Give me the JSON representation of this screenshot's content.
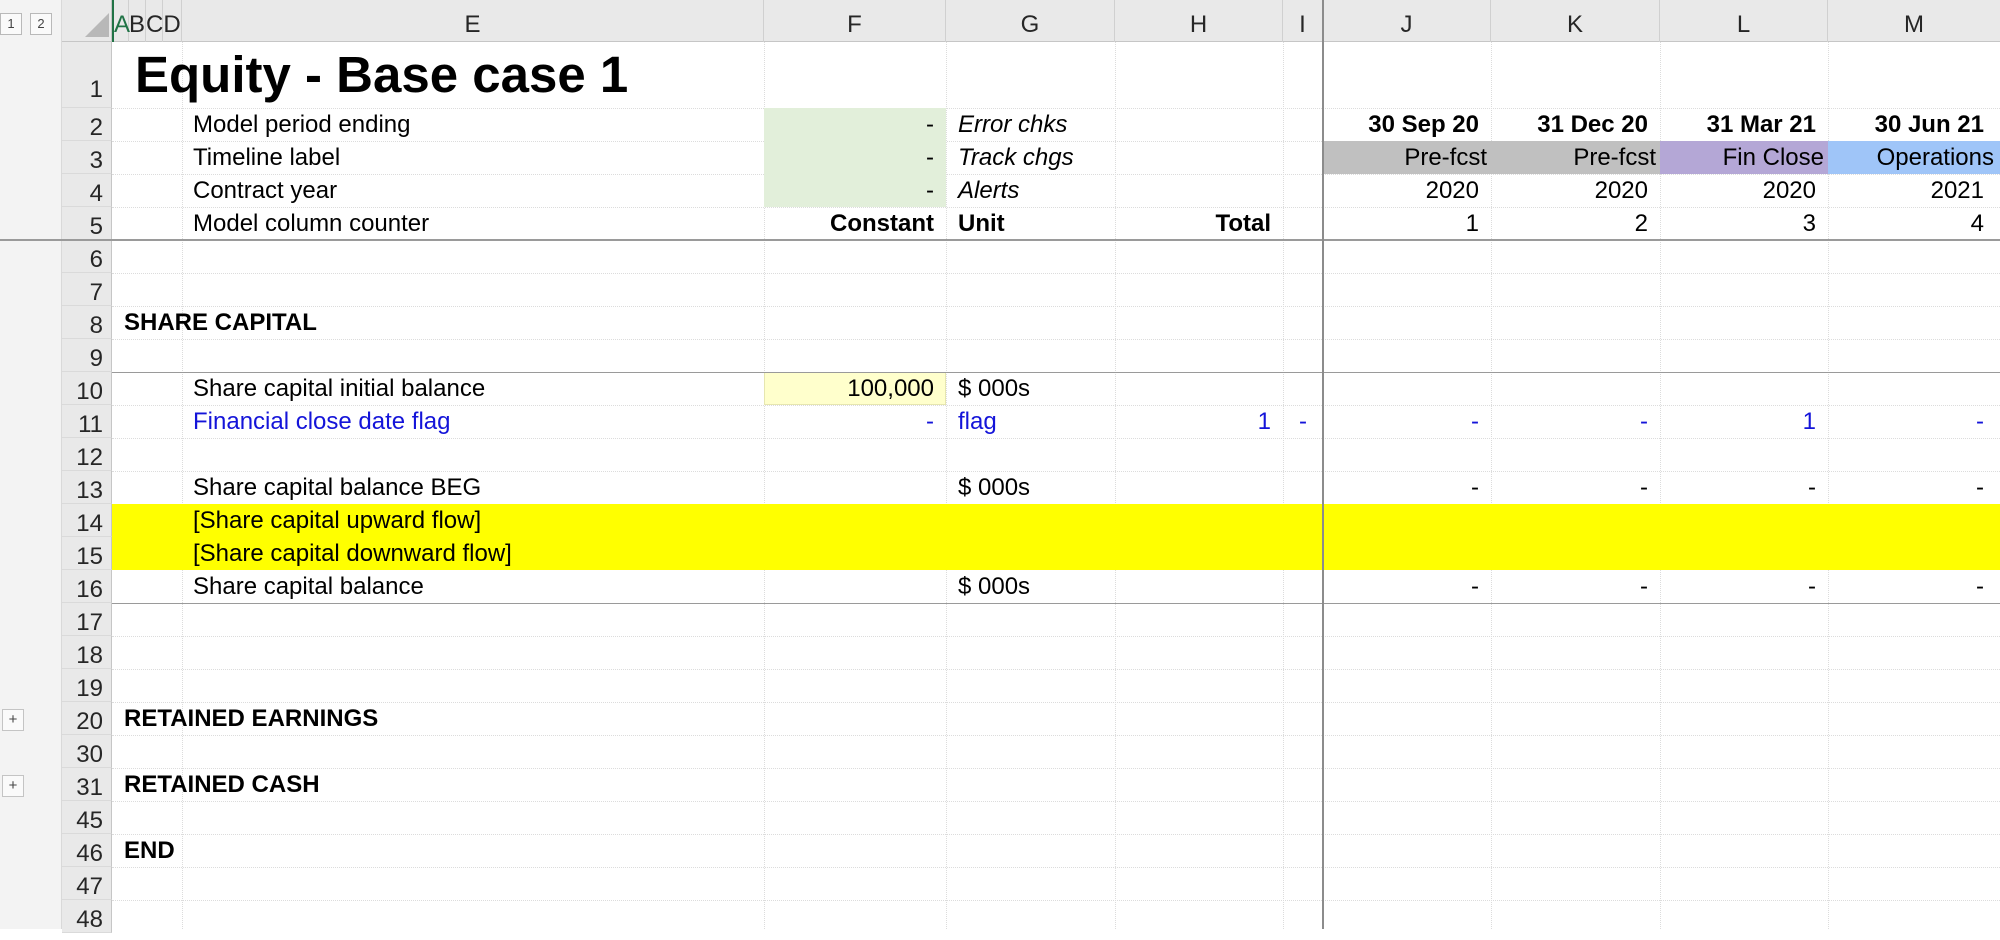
{
  "outline": {
    "level1": "1",
    "level2": "2",
    "expand": "+"
  },
  "columns": [
    "A",
    "B",
    "C",
    "D",
    "E",
    "F",
    "G",
    "H",
    "I",
    "J",
    "K",
    "L",
    "M"
  ],
  "rows": [
    "1",
    "2",
    "3",
    "4",
    "5",
    "6",
    "7",
    "8",
    "9",
    "10",
    "11",
    "12",
    "13",
    "14",
    "15",
    "16",
    "17",
    "18",
    "19",
    "20",
    "30",
    "31",
    "45",
    "46",
    "47",
    "48"
  ],
  "title": "Equity - Base case 1",
  "header_rows": {
    "model_period_ending": "Model period ending",
    "timeline_label": "Timeline label",
    "contract_year": "Contract year",
    "model_column_counter": "Model column counter",
    "f2": "-",
    "f3": "-",
    "f4": "-",
    "error_chks": "Error chks",
    "track_chgs": "Track chgs",
    "alerts": "Alerts",
    "constant": "Constant",
    "unit": "Unit",
    "total": "Total"
  },
  "periods": [
    {
      "date": "30 Sep 20",
      "label": "Pre-fcst",
      "year": "2020",
      "counter": "1",
      "label_color": "#c0c0c0"
    },
    {
      "date": "31 Dec 20",
      "label": "Pre-fcst",
      "year": "2020",
      "counter": "2",
      "label_color": "#c0c0c0"
    },
    {
      "date": "31 Mar 21",
      "label": "Fin Close",
      "year": "2020",
      "counter": "3",
      "label_color": "#b4a7d6"
    },
    {
      "date": "30 Jun 21",
      "label": "Operations",
      "year": "2021",
      "counter": "4",
      "label_color": "#9fc5f8"
    }
  ],
  "share_capital": {
    "section": "SHARE CAPITAL",
    "initial_balance_label": "Share capital initial balance",
    "initial_balance_value": "100,000",
    "initial_balance_unit": "$ 000s",
    "fc_flag_label": "Financial close date flag",
    "fc_flag_f": "-",
    "fc_flag_unit": "flag",
    "fc_flag_total": "1",
    "fc_flag_i": "-",
    "fc_flag_values": [
      "-",
      "-",
      "1",
      "-"
    ],
    "beg_label": "Share capital balance BEG",
    "beg_unit": "$ 000s",
    "beg_values": [
      "-",
      "-",
      "-",
      "-"
    ],
    "upward_label": "[Share capital upward flow]",
    "downward_label": "[Share capital downward flow]",
    "balance_label": "Share capital balance",
    "balance_unit": "$ 000s",
    "balance_values": [
      "-",
      "-",
      "-",
      "-"
    ]
  },
  "sections": {
    "retained_earnings": "RETAINED EARNINGS",
    "retained_cash": "RETAINED CASH",
    "end": "END"
  },
  "colors": {
    "input_green": "#e2efda",
    "input_yellow": "#ffffcc",
    "highlight_yellow": "#ffff00",
    "link_blue": "#1414d9"
  }
}
